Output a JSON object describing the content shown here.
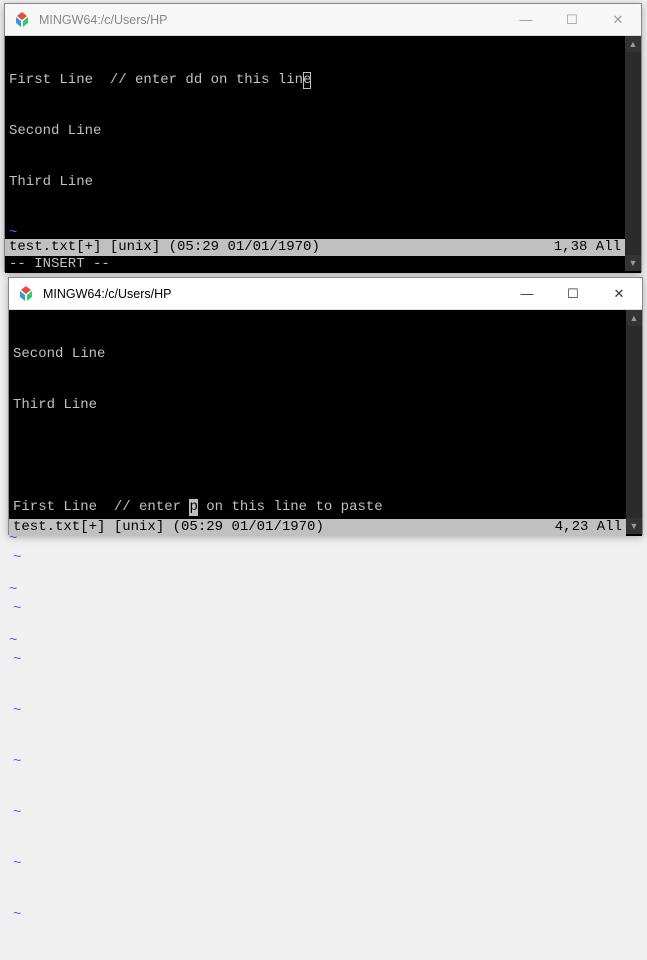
{
  "window1": {
    "title": "MINGW64:/c/Users/HP",
    "lines": {
      "l1a": "First Line  // enter dd on this lin",
      "l1b": "e",
      "l2": "Second Line",
      "l3": "Third Line"
    },
    "status_file": "test.txt",
    "status_flags": "[+] [unix] (05:29 01/01/1970)",
    "status_pos": "1,38 All",
    "mode": "-- INSERT --"
  },
  "window2": {
    "title": "MINGW64:/c/Users/HP",
    "lines": {
      "l1": "Second Line",
      "l2": "Third Line",
      "l4a": "First Line  // enter ",
      "l4b": "p",
      "l4c": " on this line to paste"
    },
    "status_file": "test.txt",
    "status_flags": "[+] [unix] (05:29 01/01/1970)",
    "status_pos": "4,23 All"
  },
  "tilde": "~",
  "controls": {
    "min": "—",
    "max": "☐",
    "close": "✕"
  },
  "scroll": {
    "up": "▲",
    "down": "▼"
  }
}
